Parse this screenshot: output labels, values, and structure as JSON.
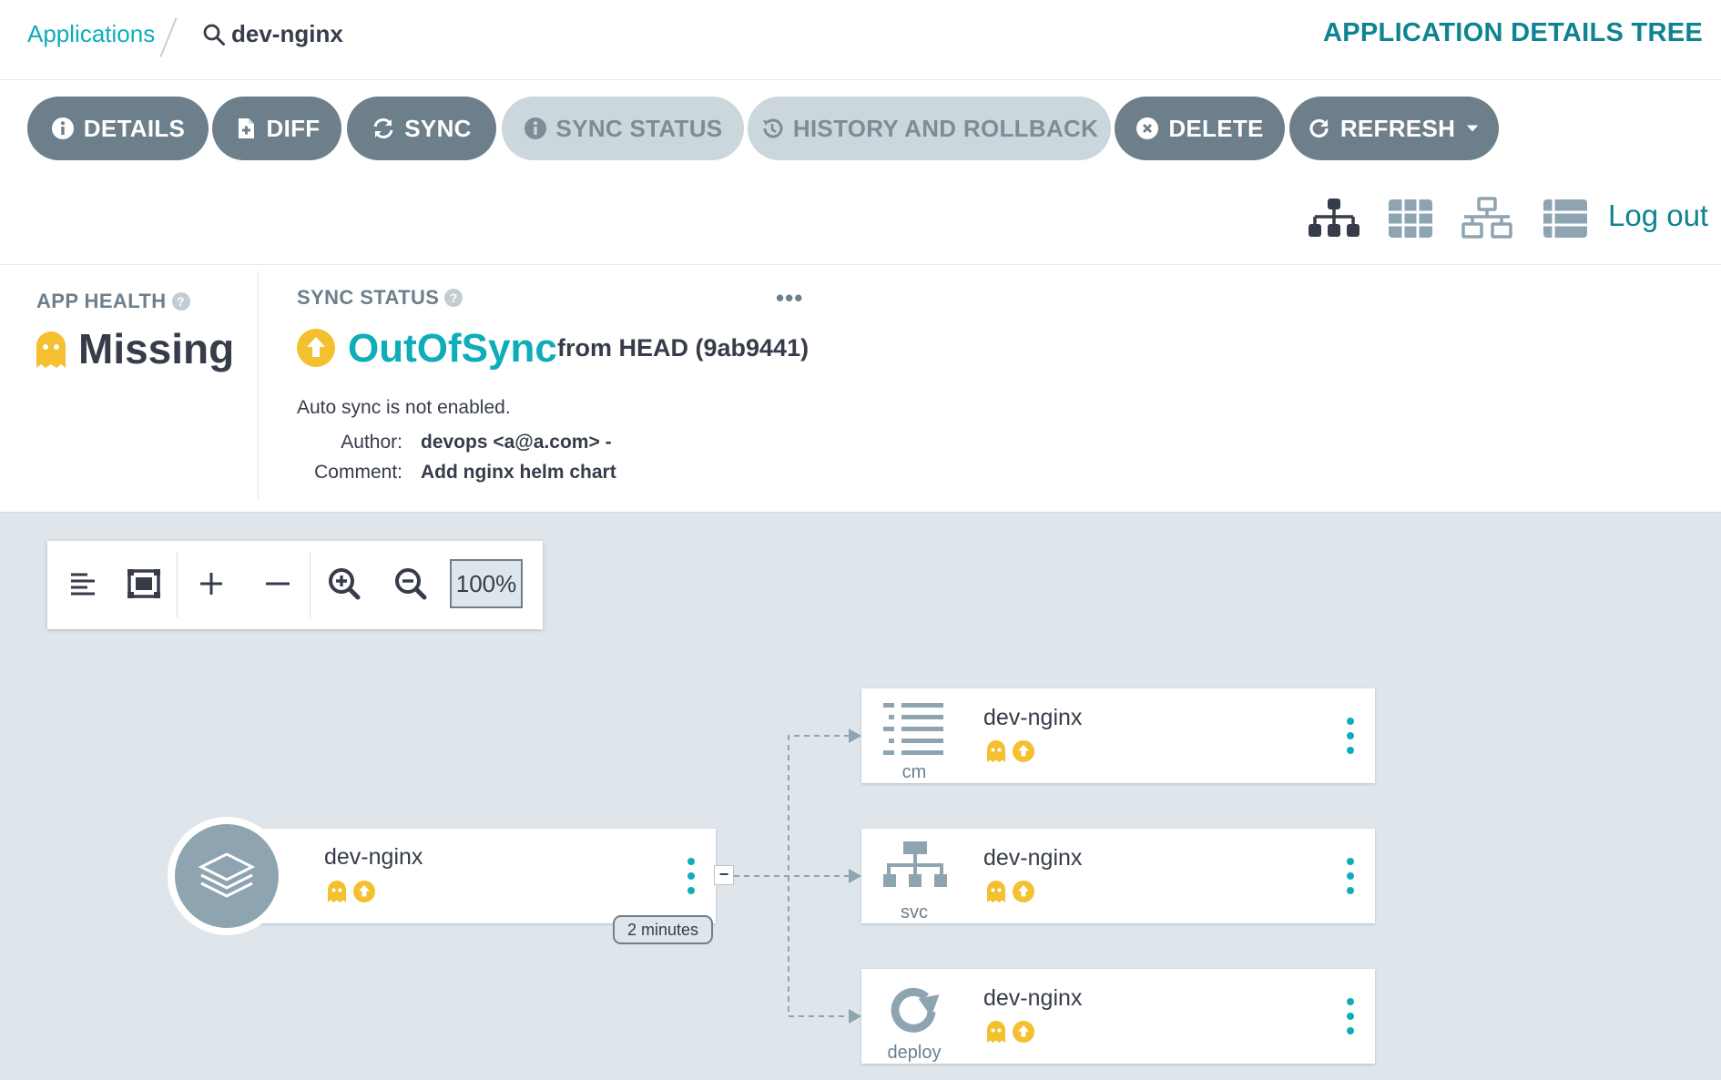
{
  "breadcrumb": {
    "root": "Applications",
    "current": "dev-nginx"
  },
  "page_title": "APPLICATION DETAILS TREE",
  "actions": [
    {
      "label": "DETAILS",
      "icon": "info-icon",
      "enabled": true
    },
    {
      "label": "DIFF",
      "icon": "file-diff-icon",
      "enabled": true
    },
    {
      "label": "SYNC",
      "icon": "sync-icon",
      "enabled": true
    },
    {
      "label": "SYNC STATUS",
      "icon": "info-icon",
      "enabled": false
    },
    {
      "label": "HISTORY AND ROLLBACK",
      "icon": "history-icon",
      "enabled": false
    },
    {
      "label": "DELETE",
      "icon": "close-circle-icon",
      "enabled": true
    },
    {
      "label": "REFRESH",
      "icon": "refresh-icon",
      "enabled": true,
      "has_dropdown": true
    }
  ],
  "view_modes": [
    "tree-view-icon",
    "pods-grid-view-icon",
    "network-view-icon",
    "list-view-icon"
  ],
  "logout": "Log out",
  "app_health": {
    "label": "APP HEALTH",
    "value": "Missing",
    "help": "?"
  },
  "sync_status": {
    "label": "SYNC STATUS",
    "help": "?",
    "more": "•••",
    "value": "OutOfSync",
    "from": "from HEAD (9ab9441)",
    "auto_sync": "Auto sync is not enabled.",
    "author_key": "Author:",
    "author": "devops <a@a.com> -",
    "comment_key": "Comment:",
    "comment": "Add nginx helm chart"
  },
  "graph_toolbar": {
    "tools": [
      "align-left-icon",
      "fit-screen-icon",
      "expand-plus-icon",
      "collapse-minus-icon",
      "zoom-in-icon",
      "zoom-out-icon"
    ],
    "zoom": "100%"
  },
  "app_node": {
    "name": "dev-nginx",
    "age": "2 minutes",
    "collapse": "−"
  },
  "resources": [
    {
      "name": "dev-nginx",
      "kind": "cm"
    },
    {
      "name": "dev-nginx",
      "kind": "svc"
    },
    {
      "name": "dev-nginx",
      "kind": "deploy"
    }
  ],
  "colors": {
    "accent": "#0dadba",
    "title": "#0e8391",
    "button": "#6d7f8b",
    "button_disabled": "#ccd6dd",
    "health_missing": "#f4c030",
    "canvas": "#dee6eb"
  }
}
